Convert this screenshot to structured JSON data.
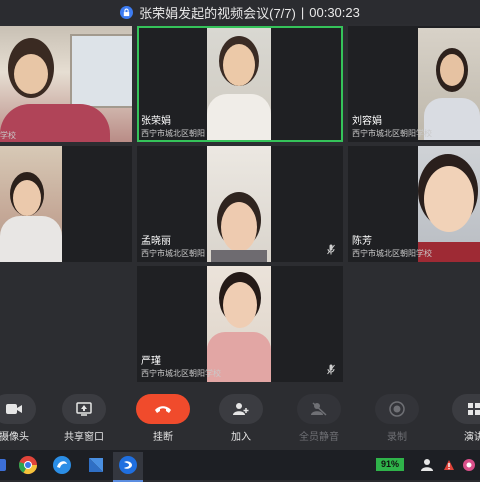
{
  "title": {
    "meeting": "张荣娟发起的视频会议(7/7)",
    "separator": "|",
    "timer": "00:30:23"
  },
  "participants": [
    {
      "name": "",
      "org": "学校"
    },
    {
      "name": "张荣娟",
      "org": "西宁市城北区朝阳"
    },
    {
      "name": "刘容娟",
      "org": "西宁市城北区朝阳学校"
    },
    {
      "name": "",
      "org": ""
    },
    {
      "name": "孟晓丽",
      "org": "西宁市城北区朝阳"
    },
    {
      "name": "陈芳",
      "org": "西宁市城北区朝阳学校"
    },
    {
      "name": "严瑾",
      "org": "西宁市城北区朝阳学校"
    }
  ],
  "toolbar": {
    "camera": "摄像头",
    "share": "共享窗口",
    "hangup": "挂断",
    "add": "加入",
    "muteall": "全员静音",
    "record": "录制",
    "present": "演讲"
  },
  "taskbar": {
    "battery": "91%"
  },
  "colors": {
    "active_border": "#35c35a",
    "hangup": "#f04b2c",
    "lock": "#3d7cf2"
  }
}
